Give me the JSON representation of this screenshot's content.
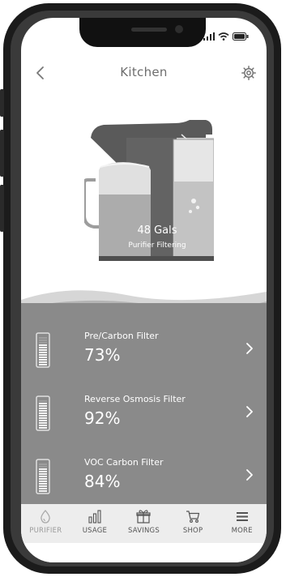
{
  "header": {
    "title": "Kitchen"
  },
  "purifier": {
    "gallons": "48 Gals",
    "status": "Purifier Filtering"
  },
  "filters": [
    {
      "name": "Pre/Carbon Filter",
      "percent": "73%",
      "level": 0.73
    },
    {
      "name": "Reverse Osmosis Filter",
      "percent": "92%",
      "level": 0.92
    },
    {
      "name": "VOC Carbon Filter",
      "percent": "84%",
      "level": 0.84
    }
  ],
  "tabs": [
    {
      "label": "PURIFIER",
      "icon": "drop-icon",
      "active": false
    },
    {
      "label": "USAGE",
      "icon": "bar-chart-icon",
      "active": true
    },
    {
      "label": "SAVINGS",
      "icon": "gift-icon",
      "active": true
    },
    {
      "label": "SHOP",
      "icon": "cart-icon",
      "active": true
    },
    {
      "label": "MORE",
      "icon": "menu-icon",
      "active": true
    }
  ],
  "colors": {
    "panel": "#8a8a8a",
    "tabbar": "#ededed",
    "text_muted": "#6d6d6d"
  }
}
